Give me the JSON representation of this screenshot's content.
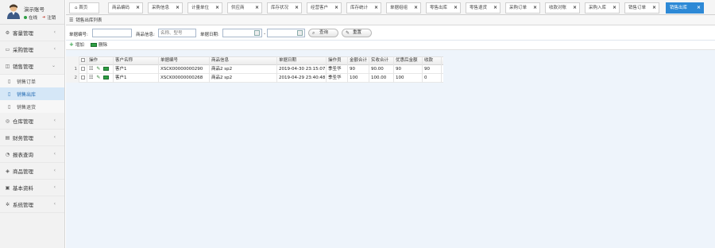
{
  "user": {
    "name": "演示账号",
    "status": "在线",
    "logout": "注销"
  },
  "sidebar": {
    "items": [
      {
        "label": "客量管理",
        "icon": "gear-icon"
      },
      {
        "label": "采购管理",
        "icon": "cart-icon"
      },
      {
        "label": "销售管理",
        "icon": "sales-icon",
        "open": true,
        "children": [
          {
            "label": "销售订单",
            "active": false
          },
          {
            "label": "销售出库",
            "active": true
          },
          {
            "label": "销售退货",
            "active": false
          }
        ]
      },
      {
        "label": "仓库管理",
        "icon": "warehouse-icon"
      },
      {
        "label": "财务管理",
        "icon": "finance-icon"
      },
      {
        "label": "报表查询",
        "icon": "report-icon"
      },
      {
        "label": "商品管理",
        "icon": "goods-icon"
      },
      {
        "label": "基本资料",
        "icon": "data-icon"
      },
      {
        "label": "系统管理",
        "icon": "system-icon"
      }
    ]
  },
  "tabs": [
    {
      "label": "首页"
    },
    {
      "label": "商品编码"
    },
    {
      "label": "采购信息"
    },
    {
      "label": "计量单位"
    },
    {
      "label": "供应商"
    },
    {
      "label": "库存状况"
    },
    {
      "label": "经营客户"
    },
    {
      "label": "库存统计"
    },
    {
      "label": "单据组组"
    },
    {
      "label": "零售出库"
    },
    {
      "label": "零售退货"
    },
    {
      "label": "采购订单"
    },
    {
      "label": "收款对账"
    },
    {
      "label": "采购入库"
    },
    {
      "label": "销售订单"
    },
    {
      "label": "销售出库"
    }
  ],
  "panel": {
    "title": "销售出库列表"
  },
  "search": {
    "doc_label": "单据编号:",
    "product_label": "商品信息:",
    "product_placeholder": "名称、型号",
    "date_label": "单据日期:",
    "date_sep": "-",
    "query_label": "查询",
    "reset_label": "重置"
  },
  "toolbar": {
    "add_label": "增加",
    "delete_label": "删除"
  },
  "table": {
    "headers": [
      "",
      "",
      "操作",
      "客户名称",
      "单据编号",
      "商品信息",
      "单据日期",
      "操作员",
      "金额合计",
      "实收合计",
      "优惠后金额",
      "收款"
    ],
    "rows": [
      {
        "num": "1",
        "customer": "客户1",
        "doc": "XSCK00000000290",
        "product": "商品2 sp2",
        "date": "2019-04-30 23:15:07",
        "operator": "季圣华",
        "total": "90",
        "received": "90.00",
        "after_discount": "90",
        "paid": "90"
      },
      {
        "num": "2",
        "customer": "客户1",
        "doc": "XSCK00000000268",
        "product": "商品2 sp2",
        "date": "2019-04-29 23:40:48",
        "operator": "季圣华",
        "total": "100",
        "received": "100.00",
        "after_discount": "100",
        "paid": "0"
      }
    ]
  },
  "colors": {
    "accent": "#2d89d6",
    "active_sub": "#d5e7f7",
    "content_bg": "#eef4fb"
  }
}
